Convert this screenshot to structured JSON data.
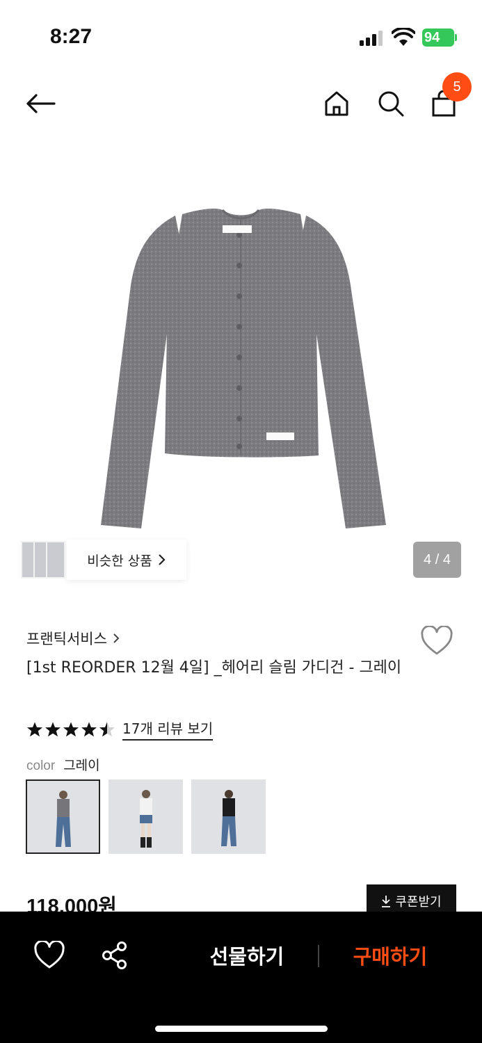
{
  "status": {
    "time": "8:27",
    "battery": "94"
  },
  "header": {
    "cart_count": "5"
  },
  "gallery": {
    "counter": "4 / 4",
    "similar_label": "비슷한 상품"
  },
  "product": {
    "brand": "프랜틱서비스",
    "title": "[1st REORDER 12월 4일] _헤어리 슬림 가디건 - 그레이",
    "rating": 4.5,
    "review_link": "17개 리뷰 보기",
    "color_label": "color",
    "color_value": "그레이",
    "price": "118,000원",
    "coupon_label": "쿠폰받기"
  },
  "colors": {
    "accent": "#ff4d14",
    "battery_green": "#34c759",
    "sweater": "#7c7b80"
  },
  "bottom_bar": {
    "gift_label": "선물하기",
    "buy_label": "구매하기"
  }
}
